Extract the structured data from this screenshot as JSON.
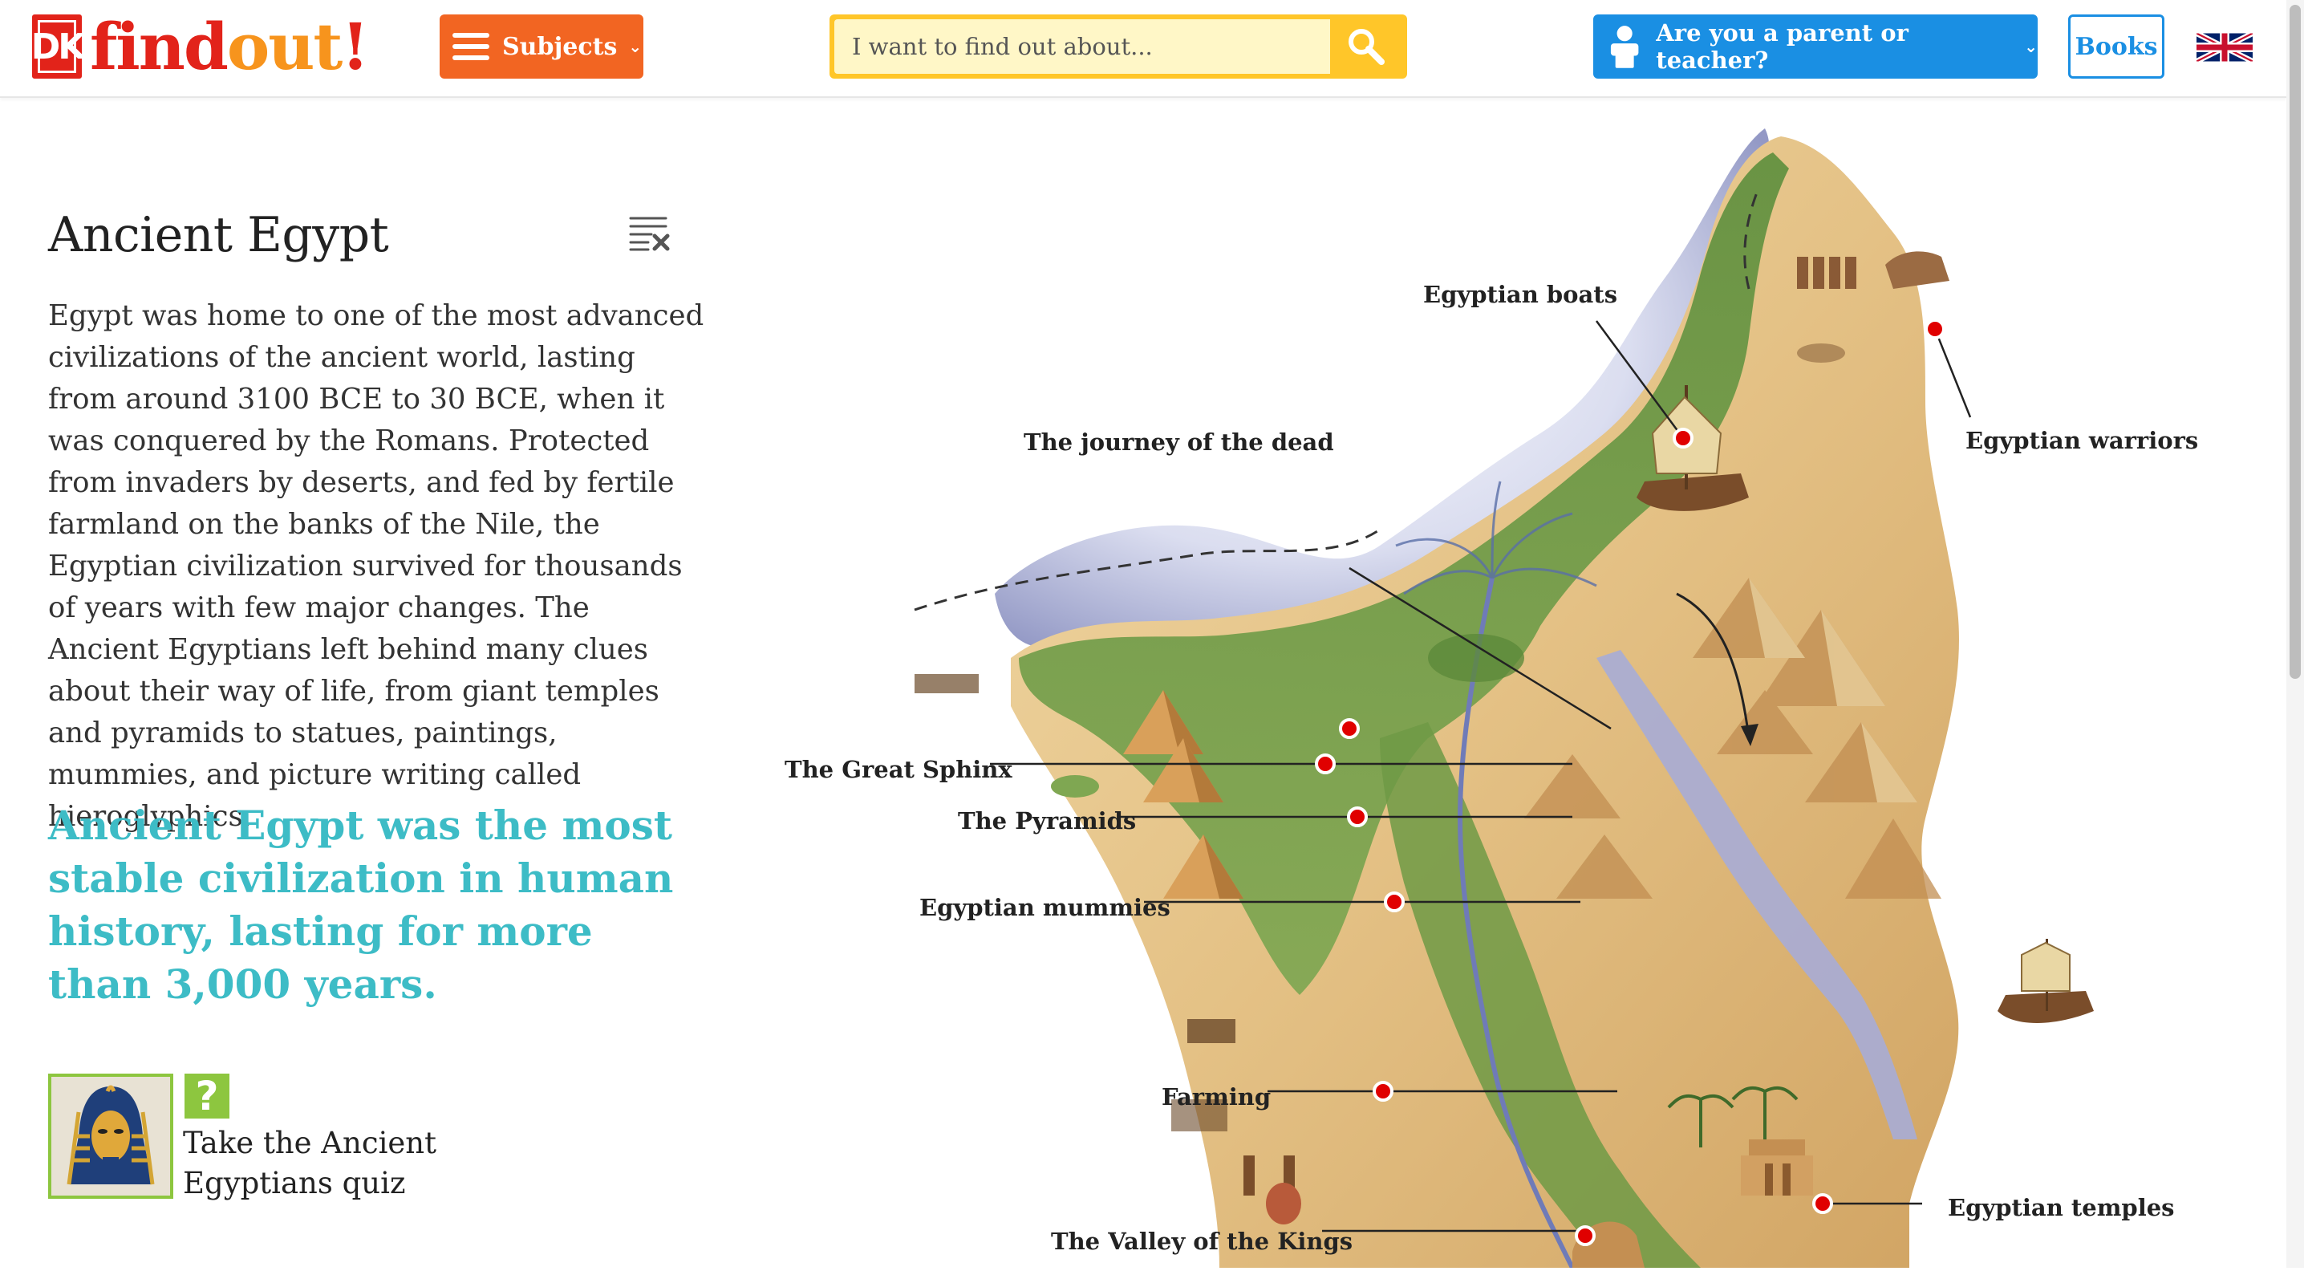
{
  "header": {
    "logo_dk": "DK",
    "logo_find": "find",
    "logo_out": "out",
    "logo_bang": "!",
    "subjects_label": "Subjects",
    "subjects_chevron": "⌄",
    "search_placeholder": "I want to find out about...",
    "parent_label": "Are you a parent or teacher?",
    "parent_chevron": "⌄",
    "books_label": "Books"
  },
  "article": {
    "title": "Ancient Egypt",
    "body": "Egypt was home to one of the most advanced civilizations of the ancient world, lasting from around 3100 BCE to 30 BCE, when it was conquered by the Romans. Protected from invaders by deserts, and fed by fertile farmland on the banks of the Nile, the Egyptian civilization survived for thousands of years with few major changes. The Ancient Egyptians left behind many clues about their way of life, from giant temples and pyramids to statues, paintings, mummies, and picture writing called hieroglyphics.",
    "fact": "Ancient Egypt was the most stable civilization in human history, lasting for more than 3,000 years.",
    "quiz_badge": "?",
    "quiz_label": "Take the Ancient Egyptians quiz"
  },
  "map": {
    "labels": {
      "boats": "Egyptian boats",
      "warriors": "Egyptian warriors",
      "journey": "The journey of the dead",
      "sphinx": "The Great Sphinx",
      "pyramids": "The Pyramids",
      "mummies": "Egyptian mummies",
      "farming": "Farming",
      "temples": "Egyptian temples",
      "valley": "The Valley of the Kings"
    }
  },
  "colors": {
    "brand_red": "#e2231a",
    "brand_orange": "#f7941d",
    "subjects_orange": "#f26522",
    "search_yellow": "#ffc629",
    "parent_blue": "#1a8fe3",
    "fact_teal": "#3dbcc6",
    "quiz_green": "#8dc63f",
    "hotspot_red": "#e00000"
  },
  "icons": [
    "hamburger-icon",
    "search-icon",
    "person-icon",
    "uk-flag-icon",
    "close-list-icon",
    "pharaoh-mask-icon",
    "map-hotspot-icon"
  ]
}
